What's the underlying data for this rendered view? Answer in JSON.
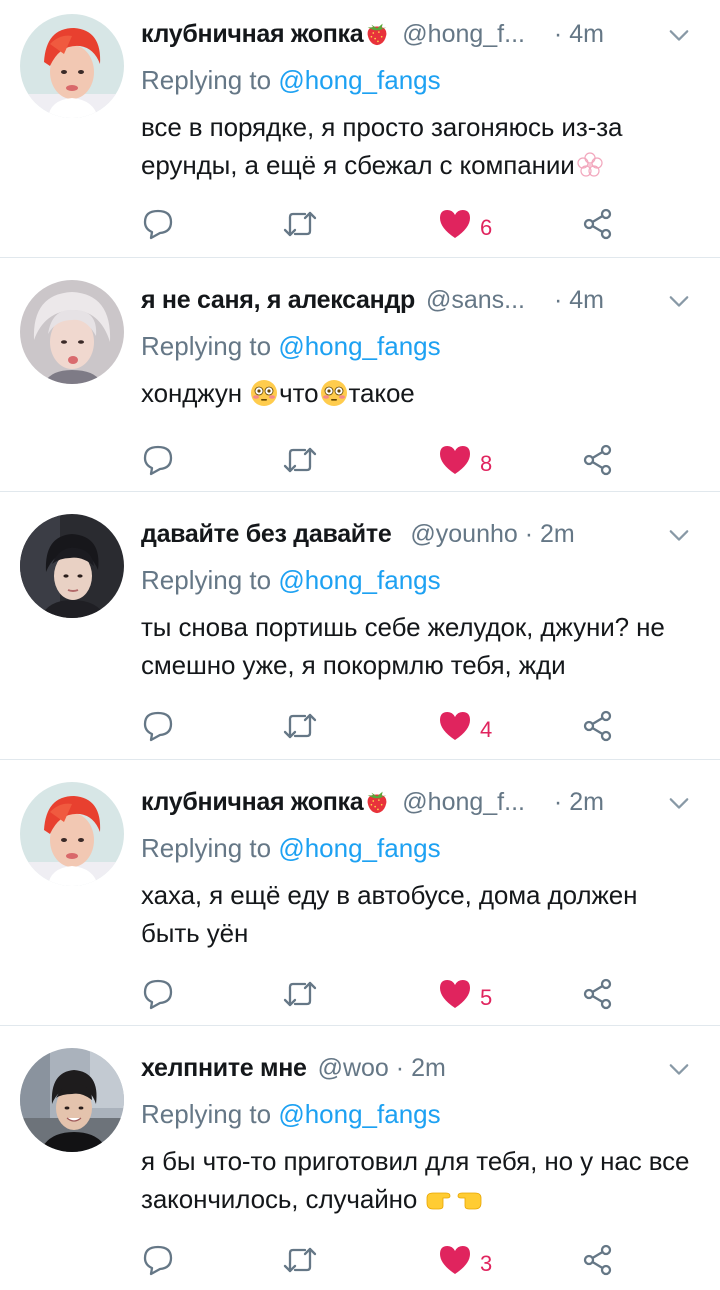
{
  "reply_prefix": "Replying to",
  "colors": {
    "accent": "#1da1f2",
    "like": "#e0245e",
    "muted": "#657786",
    "divider": "#e1e8ed"
  },
  "tweets": [
    {
      "name": "клубничная жопка",
      "name_emoji": "strawberry-emoji",
      "handle": "@hong_f...",
      "time": "4m",
      "reply_to": "@hong_fangs",
      "text_parts": [
        "все в порядке, я просто загоняюсь из-за ерунды, а ещё я сбежал с компании"
      ],
      "emojis": [
        "blossom-emoji"
      ],
      "likes": "6"
    },
    {
      "name": "я не саня, я александр",
      "handle": "@sans...",
      "time": "4m",
      "reply_to": "@hong_fangs",
      "text_parts": [
        "хонджун ",
        "что",
        "такое"
      ],
      "emojis": [
        "flushed-emoji",
        "flushed-emoji"
      ],
      "likes": "8"
    },
    {
      "name": "давайте без давайте",
      "handle": "@younho",
      "time": "2m",
      "reply_to": "@hong_fangs",
      "text_parts": [
        "ты снова портишь себе желудок, джуни? не смешно уже, я покормлю тебя, жди"
      ],
      "likes": "4"
    },
    {
      "name": "клубничная жопка",
      "name_emoji": "strawberry-emoji",
      "handle": "@hong_f...",
      "time": "2m",
      "reply_to": "@hong_fangs",
      "text_parts": [
        "хаха, я ещё еду в автобусе, дома должен быть уён"
      ],
      "likes": "5"
    },
    {
      "name": "хелпните мне",
      "handle": "@woo",
      "time": "2m",
      "reply_to": "@hong_fangs",
      "text_parts": [
        "я бы что-то приготовил для тебя, но у нас все закончилось, случайно "
      ],
      "emojis": [
        "pointing-hands-emoji"
      ],
      "likes": "3"
    }
  ]
}
